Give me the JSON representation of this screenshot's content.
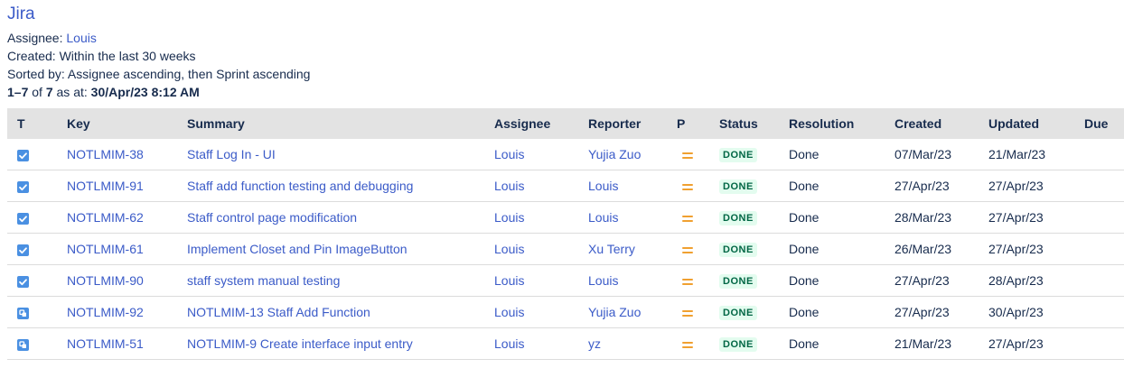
{
  "header": {
    "title": "Jira",
    "assignee_label": "Assignee: ",
    "assignee_value": "Louis",
    "created": "Created: Within the last 30 weeks",
    "sorted": "Sorted by: Assignee ascending, then Sprint ascending",
    "range": "1–7",
    "of_text": " of ",
    "total": "7",
    "as_at_text": " as at: ",
    "timestamp": "30/Apr/23 8:12 AM"
  },
  "table": {
    "columns": [
      "T",
      "Key",
      "Summary",
      "Assignee",
      "Reporter",
      "P",
      "Status",
      "Resolution",
      "Created",
      "Updated",
      "Due"
    ],
    "rows": [
      {
        "type": "task-icon",
        "key": "NOTLMIM-38",
        "summary": "Staff Log In - UI",
        "assignee": "Louis",
        "reporter": "Yujia Zuo",
        "priority": "medium-priority-icon",
        "status": "DONE",
        "resolution": "Done",
        "created": "07/Mar/23",
        "updated": "21/Mar/23",
        "due": ""
      },
      {
        "type": "task-icon",
        "key": "NOTLMIM-91",
        "summary": "Staff add function testing and debugging",
        "assignee": "Louis",
        "reporter": "Louis",
        "priority": "medium-priority-icon",
        "status": "DONE",
        "resolution": "Done",
        "created": "27/Apr/23",
        "updated": "27/Apr/23",
        "due": ""
      },
      {
        "type": "task-icon",
        "key": "NOTLMIM-62",
        "summary": "Staff control page modification",
        "assignee": "Louis",
        "reporter": "Louis",
        "priority": "medium-priority-icon",
        "status": "DONE",
        "resolution": "Done",
        "created": "28/Mar/23",
        "updated": "27/Apr/23",
        "due": ""
      },
      {
        "type": "task-icon",
        "key": "NOTLMIM-61",
        "summary": "Implement Closet and Pin ImageButton",
        "assignee": "Louis",
        "reporter": "Xu Terry",
        "priority": "medium-priority-icon",
        "status": "DONE",
        "resolution": "Done",
        "created": "26/Mar/23",
        "updated": "27/Apr/23",
        "due": ""
      },
      {
        "type": "task-icon",
        "key": "NOTLMIM-90",
        "summary": "staff system manual testing",
        "assignee": "Louis",
        "reporter": "Louis",
        "priority": "medium-priority-icon",
        "status": "DONE",
        "resolution": "Done",
        "created": "27/Apr/23",
        "updated": "28/Apr/23",
        "due": ""
      },
      {
        "type": "subtask-icon",
        "key": "NOTLMIM-92",
        "summary": "NOTLMIM-13 Staff Add Function",
        "assignee": "Louis",
        "reporter": "Yujia Zuo",
        "priority": "medium-priority-icon",
        "status": "DONE",
        "resolution": "Done",
        "created": "27/Apr/23",
        "updated": "30/Apr/23",
        "due": ""
      },
      {
        "type": "subtask-icon",
        "key": "NOTLMIM-51",
        "summary": "NOTLMIM-9 Create interface input entry",
        "assignee": "Louis",
        "reporter": "yz",
        "priority": "medium-priority-icon",
        "status": "DONE",
        "resolution": "Done",
        "created": "21/Mar/23",
        "updated": "27/Apr/23",
        "due": ""
      }
    ]
  },
  "colors": {
    "link": "#3b5bc8",
    "header_bg": "#e3e3e3",
    "done_bg": "#e3fcef",
    "done_text": "#006644",
    "priority_medium": "#f0a030",
    "type_icon": "#4a90e2"
  }
}
